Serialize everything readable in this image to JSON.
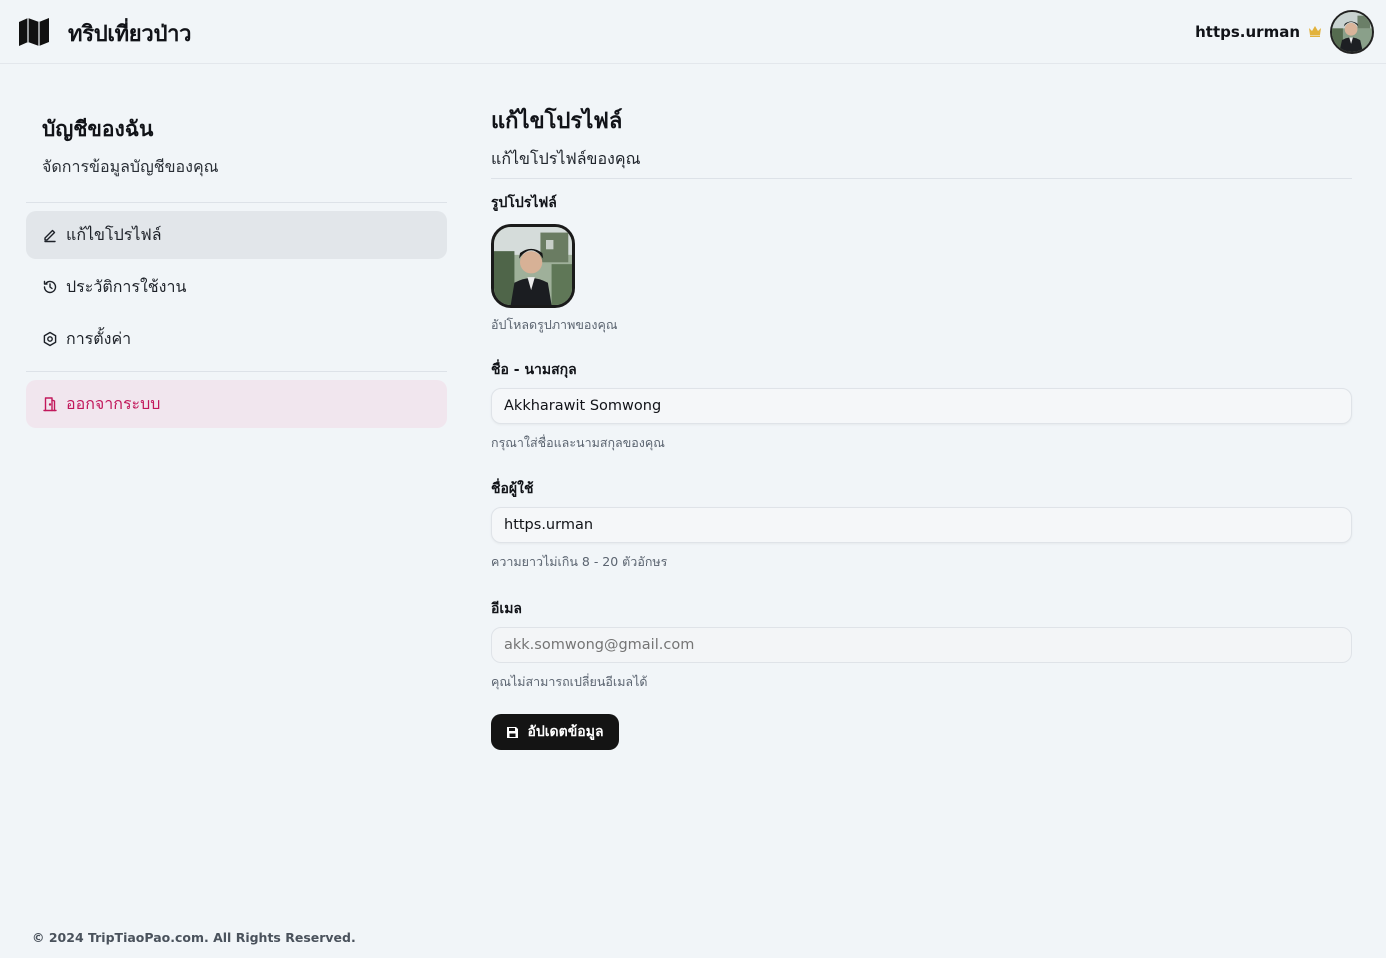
{
  "header": {
    "brand_name": "ทริปเที่ยวป่าว",
    "username": "https.urman",
    "crown_color": "#e2b23c"
  },
  "sidebar": {
    "title": "บัญชีของฉัน",
    "subtitle": "จัดการข้อมูลบัญชีของคุณ",
    "items": [
      {
        "label": "แก้ไขโปรไฟล์",
        "icon": "pencil-icon",
        "active": true
      },
      {
        "label": "ประวัติการใช้งาน",
        "icon": "history-icon",
        "active": false
      },
      {
        "label": "การตั้งค่า",
        "icon": "settings-icon",
        "active": false
      }
    ],
    "logout": {
      "label": "ออกจากระบบ",
      "icon": "door-exit-icon",
      "color": "#c2185b"
    }
  },
  "profile": {
    "title": "แก้ไขโปรไฟล์",
    "subtitle": "แก้ไขโปรไฟล์ของคุณ",
    "photo_label": "รูปโปรไฟล์",
    "photo_hint": "อัปโหลดรูปภาพของคุณ",
    "fullname": {
      "label": "ชื่อ - นามสกุล",
      "value": "Akkharawit Somwong",
      "hint": "กรุณาใส่ชื่อและนามสกุลของคุณ"
    },
    "username": {
      "label": "ชื่อผู้ใช้",
      "value": "https.urman",
      "hint": "ความยาวไม่เกิน 8 - 20 ตัวอักษร"
    },
    "email": {
      "label": "อีเมล",
      "placeholder": "akk.somwong@gmail.com",
      "hint": "คุณไม่สามารถเปลี่ยนอีเมลได้"
    },
    "submit_label": "อัปเดตข้อมูล"
  },
  "footer": {
    "copyright": "© 2024 TripTiaoPao.com. All Rights Reserved."
  }
}
